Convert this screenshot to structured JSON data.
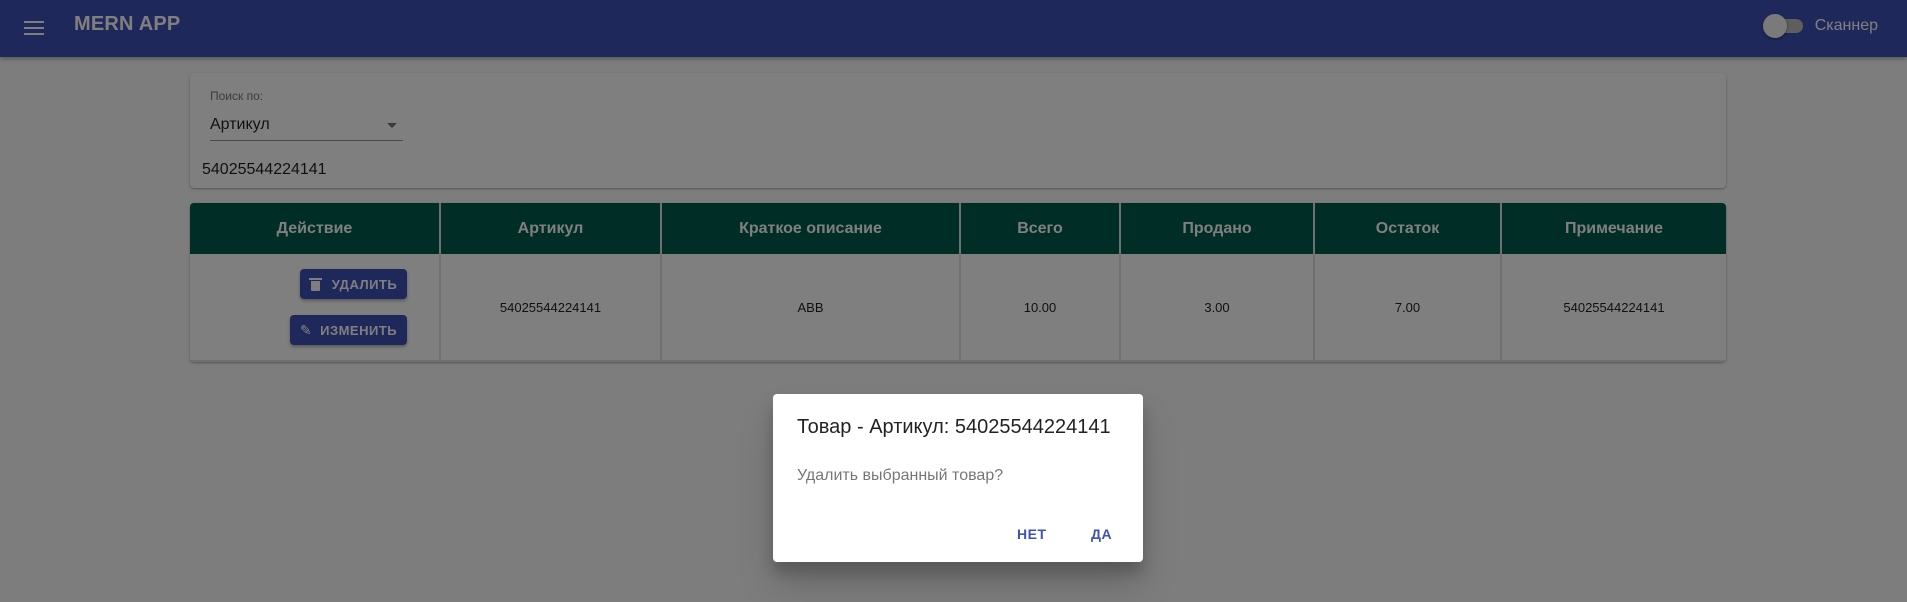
{
  "app": {
    "title": "MERN APP",
    "scanner_label": "Сканнер",
    "scanner_on": false
  },
  "search": {
    "by_label": "Поиск по:",
    "by_value": "Артикул",
    "query": "54025544224141"
  },
  "table": {
    "headers": [
      "Действие",
      "Артикул",
      "Краткое описание",
      "Всего",
      "Продано",
      "Остаток",
      "Примечание"
    ],
    "rows": [
      {
        "delete_label": "УДАЛИТЬ",
        "edit_label": "ИЗМЕНИТЬ",
        "article": "54025544224141",
        "description": "ABB",
        "total": "10.00",
        "sold": "3.00",
        "remaining": "7.00",
        "note": "54025544224141"
      }
    ]
  },
  "dialog": {
    "title": "Товар - Артикул: 54025544224141",
    "text": "Удалить выбранный товар?",
    "no_label": "НЕТ",
    "yes_label": "ДА"
  },
  "colors": {
    "appbar": "#3f51b5",
    "table_header": "#005b4a",
    "button": "#3f51b5"
  },
  "icons": {
    "menu": "menu-icon",
    "delete": "trash-icon",
    "edit": "pencil-icon"
  }
}
